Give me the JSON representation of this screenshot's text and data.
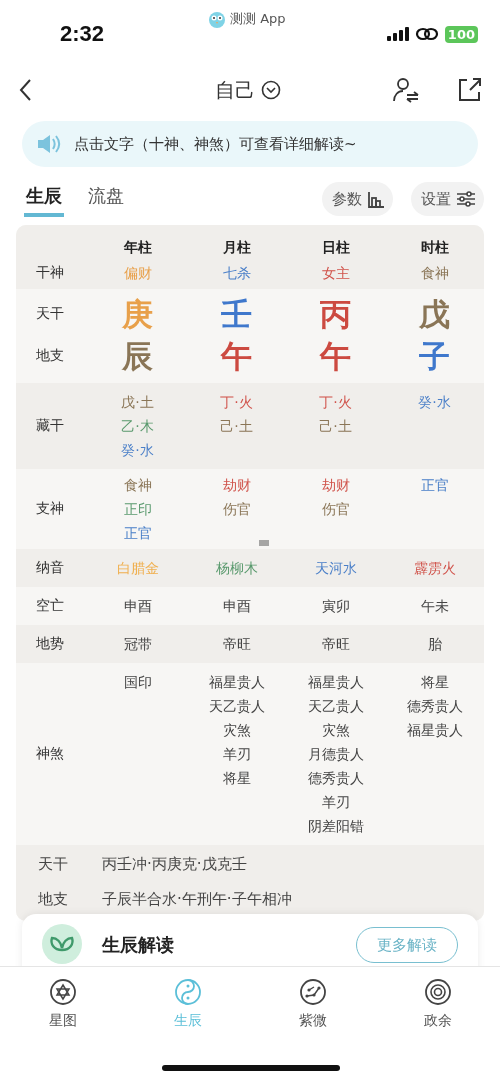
{
  "status_bar": {
    "time": "2:32",
    "app": "测测 App",
    "battery": "100"
  },
  "nav": {
    "title": "自己"
  },
  "notice": {
    "text": "点击文字（十神、神煞）可查看详细解读~"
  },
  "tabs": [
    {
      "label": "生辰",
      "selected": true
    },
    {
      "label": "流盘",
      "selected": false
    }
  ],
  "tool_buttons": [
    {
      "label": "参数",
      "kind": "params"
    },
    {
      "label": "设置",
      "kind": "settings"
    }
  ],
  "chart": {
    "columns": [
      "年柱",
      "月柱",
      "日柱",
      "时柱"
    ],
    "groups": [
      {
        "rows": [
          {
            "label": "干神",
            "kind": "small",
            "cells": [
              [
                {
                  "text": "偏财",
                  "color": "#e8a04a"
                }
              ],
              [
                {
                  "text": "七杀",
                  "color": "#4a7fc8"
                }
              ],
              [
                {
                  "text": "女主",
                  "color": "#d0524a"
                }
              ],
              [
                {
                  "text": "食神",
                  "color": "#8a7556"
                }
              ]
            ]
          }
        ]
      },
      {
        "rows": [
          {
            "label": "天干",
            "kind": "big",
            "cells": [
              [
                {
                  "text": "庚",
                  "color": "#e8a04a"
                }
              ],
              [
                {
                  "text": "壬",
                  "color": "#3f78cc"
                }
              ],
              [
                {
                  "text": "丙",
                  "color": "#cc4a40"
                }
              ],
              [
                {
                  "text": "戊",
                  "color": "#8a7556"
                }
              ]
            ]
          },
          {
            "label": "地支",
            "kind": "big",
            "cells": [
              [
                {
                  "text": "辰",
                  "color": "#8a7556"
                }
              ],
              [
                {
                  "text": "午",
                  "color": "#cc4a40"
                }
              ],
              [
                {
                  "text": "午",
                  "color": "#cc4a40"
                }
              ],
              [
                {
                  "text": "子",
                  "color": "#3f78cc"
                }
              ]
            ]
          }
        ]
      },
      {
        "rows": [
          {
            "label": "藏干",
            "kind": "small",
            "cells": [
              [
                {
                  "text": "戊·土",
                  "color": "#8a7556"
                },
                {
                  "text": "乙·木",
                  "color": "#5a9a6e"
                },
                {
                  "text": "癸·水",
                  "color": "#4a7fc8"
                }
              ],
              [
                {
                  "text": "丁·火",
                  "color": "#d0524a"
                },
                {
                  "text": "己·土",
                  "color": "#8a7556"
                }
              ],
              [
                {
                  "text": "丁·火",
                  "color": "#d0524a"
                },
                {
                  "text": "己·土",
                  "color": "#8a7556"
                }
              ],
              [
                {
                  "text": "癸·水",
                  "color": "#4a7fc8"
                }
              ]
            ]
          }
        ]
      },
      {
        "rows": [
          {
            "label": "支神",
            "kind": "small",
            "cells": [
              [
                {
                  "text": "食神",
                  "color": "#8a7556"
                },
                {
                  "text": "正印",
                  "color": "#5a9a6e"
                },
                {
                  "text": "正官",
                  "color": "#4a7fc8"
                }
              ],
              [
                {
                  "text": "劫财",
                  "color": "#d0524a"
                },
                {
                  "text": "伤官",
                  "color": "#8a7556"
                }
              ],
              [
                {
                  "text": "劫财",
                  "color": "#d0524a"
                },
                {
                  "text": "伤官",
                  "color": "#8a7556"
                }
              ],
              [
                {
                  "text": "正官",
                  "color": "#4a7fc8"
                }
              ]
            ]
          }
        ]
      },
      {
        "rows": [
          {
            "label": "纳音",
            "kind": "small",
            "cells": [
              [
                {
                  "text": "白腊金",
                  "color": "#f0b050"
                }
              ],
              [
                {
                  "text": "杨柳木",
                  "color": "#5a9a6e"
                }
              ],
              [
                {
                  "text": "天河水",
                  "color": "#4a7fc8"
                }
              ],
              [
                {
                  "text": "霹雳火",
                  "color": "#d0524a"
                }
              ]
            ]
          }
        ]
      },
      {
        "rows": [
          {
            "label": "空亡",
            "kind": "small",
            "cells": [
              [
                {
                  "text": "申酉"
                }
              ],
              [
                {
                  "text": "申酉"
                }
              ],
              [
                {
                  "text": "寅卯"
                }
              ],
              [
                {
                  "text": "午未"
                }
              ]
            ]
          }
        ]
      },
      {
        "rows": [
          {
            "label": "地势",
            "kind": "small",
            "cells": [
              [
                {
                  "text": "冠带"
                }
              ],
              [
                {
                  "text": "帝旺"
                }
              ],
              [
                {
                  "text": "帝旺"
                }
              ],
              [
                {
                  "text": "胎"
                }
              ]
            ]
          }
        ]
      },
      {
        "rows": [
          {
            "label": "神煞",
            "kind": "small",
            "cells": [
              [
                {
                  "text": "国印"
                }
              ],
              [
                {
                  "text": "福星贵人"
                },
                {
                  "text": "天乙贵人"
                },
                {
                  "text": "灾煞"
                },
                {
                  "text": "羊刃"
                },
                {
                  "text": "将星"
                }
              ],
              [
                {
                  "text": "福星贵人"
                },
                {
                  "text": "天乙贵人"
                },
                {
                  "text": "灾煞"
                },
                {
                  "text": "月德贵人"
                },
                {
                  "text": "德秀贵人"
                },
                {
                  "text": "羊刃"
                },
                {
                  "text": "阴差阳错"
                }
              ],
              [
                {
                  "text": "将星"
                },
                {
                  "text": "德秀贵人"
                },
                {
                  "text": "福星贵人"
                }
              ]
            ]
          }
        ]
      }
    ],
    "relations": [
      {
        "label": "天干",
        "text": "丙壬冲·丙庚克·戊克壬"
      },
      {
        "label": "地支",
        "text": "子辰半合水·午刑午·子午相冲"
      }
    ]
  },
  "reading_card": {
    "title": "生辰解读",
    "button": "更多解读"
  },
  "tab_bar": [
    {
      "label": "星图",
      "kind": "star",
      "selected": false
    },
    {
      "label": "生辰",
      "kind": "yinyang",
      "selected": true
    },
    {
      "label": "紫微",
      "kind": "dots",
      "selected": false
    },
    {
      "label": "政余",
      "kind": "target",
      "selected": false
    }
  ]
}
